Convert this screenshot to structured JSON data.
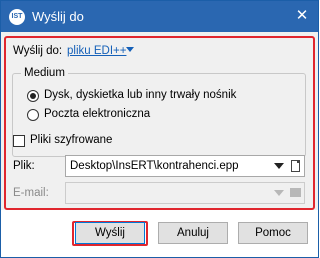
{
  "window": {
    "title": "Wyślij do",
    "app_icon_text": "IST",
    "close_glyph": "✕"
  },
  "send_to": {
    "label": "Wyślij do:",
    "link": "pliku EDI++"
  },
  "medium": {
    "title": "Medium",
    "options": [
      {
        "label": "Dysk, dyskietka lub inny trwały nośnik",
        "selected": true
      },
      {
        "label": "Poczta elektroniczna",
        "selected": false
      }
    ]
  },
  "encrypted": {
    "label": "Pliki szyfrowane",
    "checked": false
  },
  "file": {
    "label": "Plik:",
    "value": "Desktop\\InsERT\\kontrahenci.epp"
  },
  "email": {
    "label": "E-mail:",
    "value": ""
  },
  "buttons": {
    "send": "Wyślij",
    "cancel": "Anuluj",
    "help": "Pomoc"
  },
  "colors": {
    "titlebar": "#2a67b1",
    "highlight": "#e0262e",
    "link": "#1560b8"
  },
  "icons": {
    "app": "app-logo-icon",
    "close": "close-icon",
    "dropdown": "chevron-down-icon",
    "browse": "document-icon",
    "address_book": "mail-icon"
  }
}
